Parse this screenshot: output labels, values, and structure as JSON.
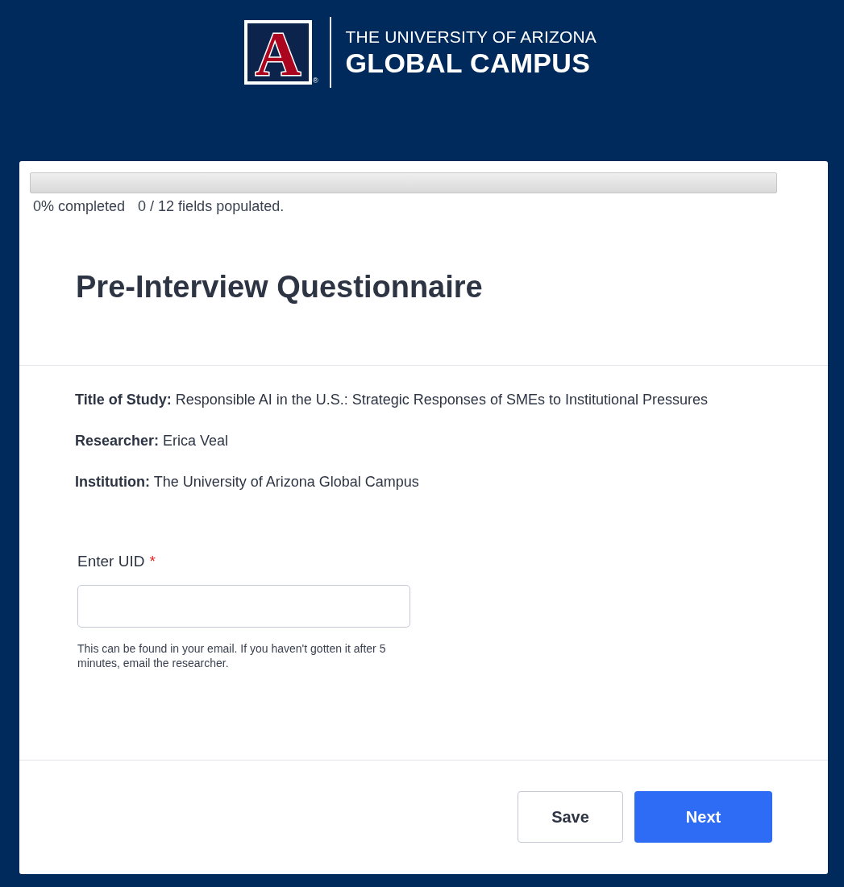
{
  "header": {
    "logo": {
      "mark": "A",
      "registered": "®",
      "line1": "THE UNIVERSITY OF ARIZONA",
      "line2": "GLOBAL CAMPUS"
    }
  },
  "progress": {
    "level": 0,
    "percent_text": "0% completed",
    "fields_text": "0 / 12 fields populated."
  },
  "form": {
    "title": "Pre-Interview Questionnaire",
    "info": [
      {
        "text": "**Title of Study:** Responsible AI in the U.S.: Strategic Responses of SMEs to Institutional Pressures"
      },
      {
        "text": "**Researcher:** Erica Veal"
      },
      {
        "text": "**Institution:** The University of Arizona Global Campus"
      }
    ],
    "fields": [
      {
        "label": "Enter UID",
        "required": true,
        "marker": "*",
        "help": "This can be found in your email. If you haven't gotten it after 5 minutes, email the researcher."
      }
    ]
  },
  "buttons": [
    {
      "label": "Save",
      "kind": "secondary"
    },
    {
      "label": "Next",
      "kind": "primary"
    }
  ]
}
